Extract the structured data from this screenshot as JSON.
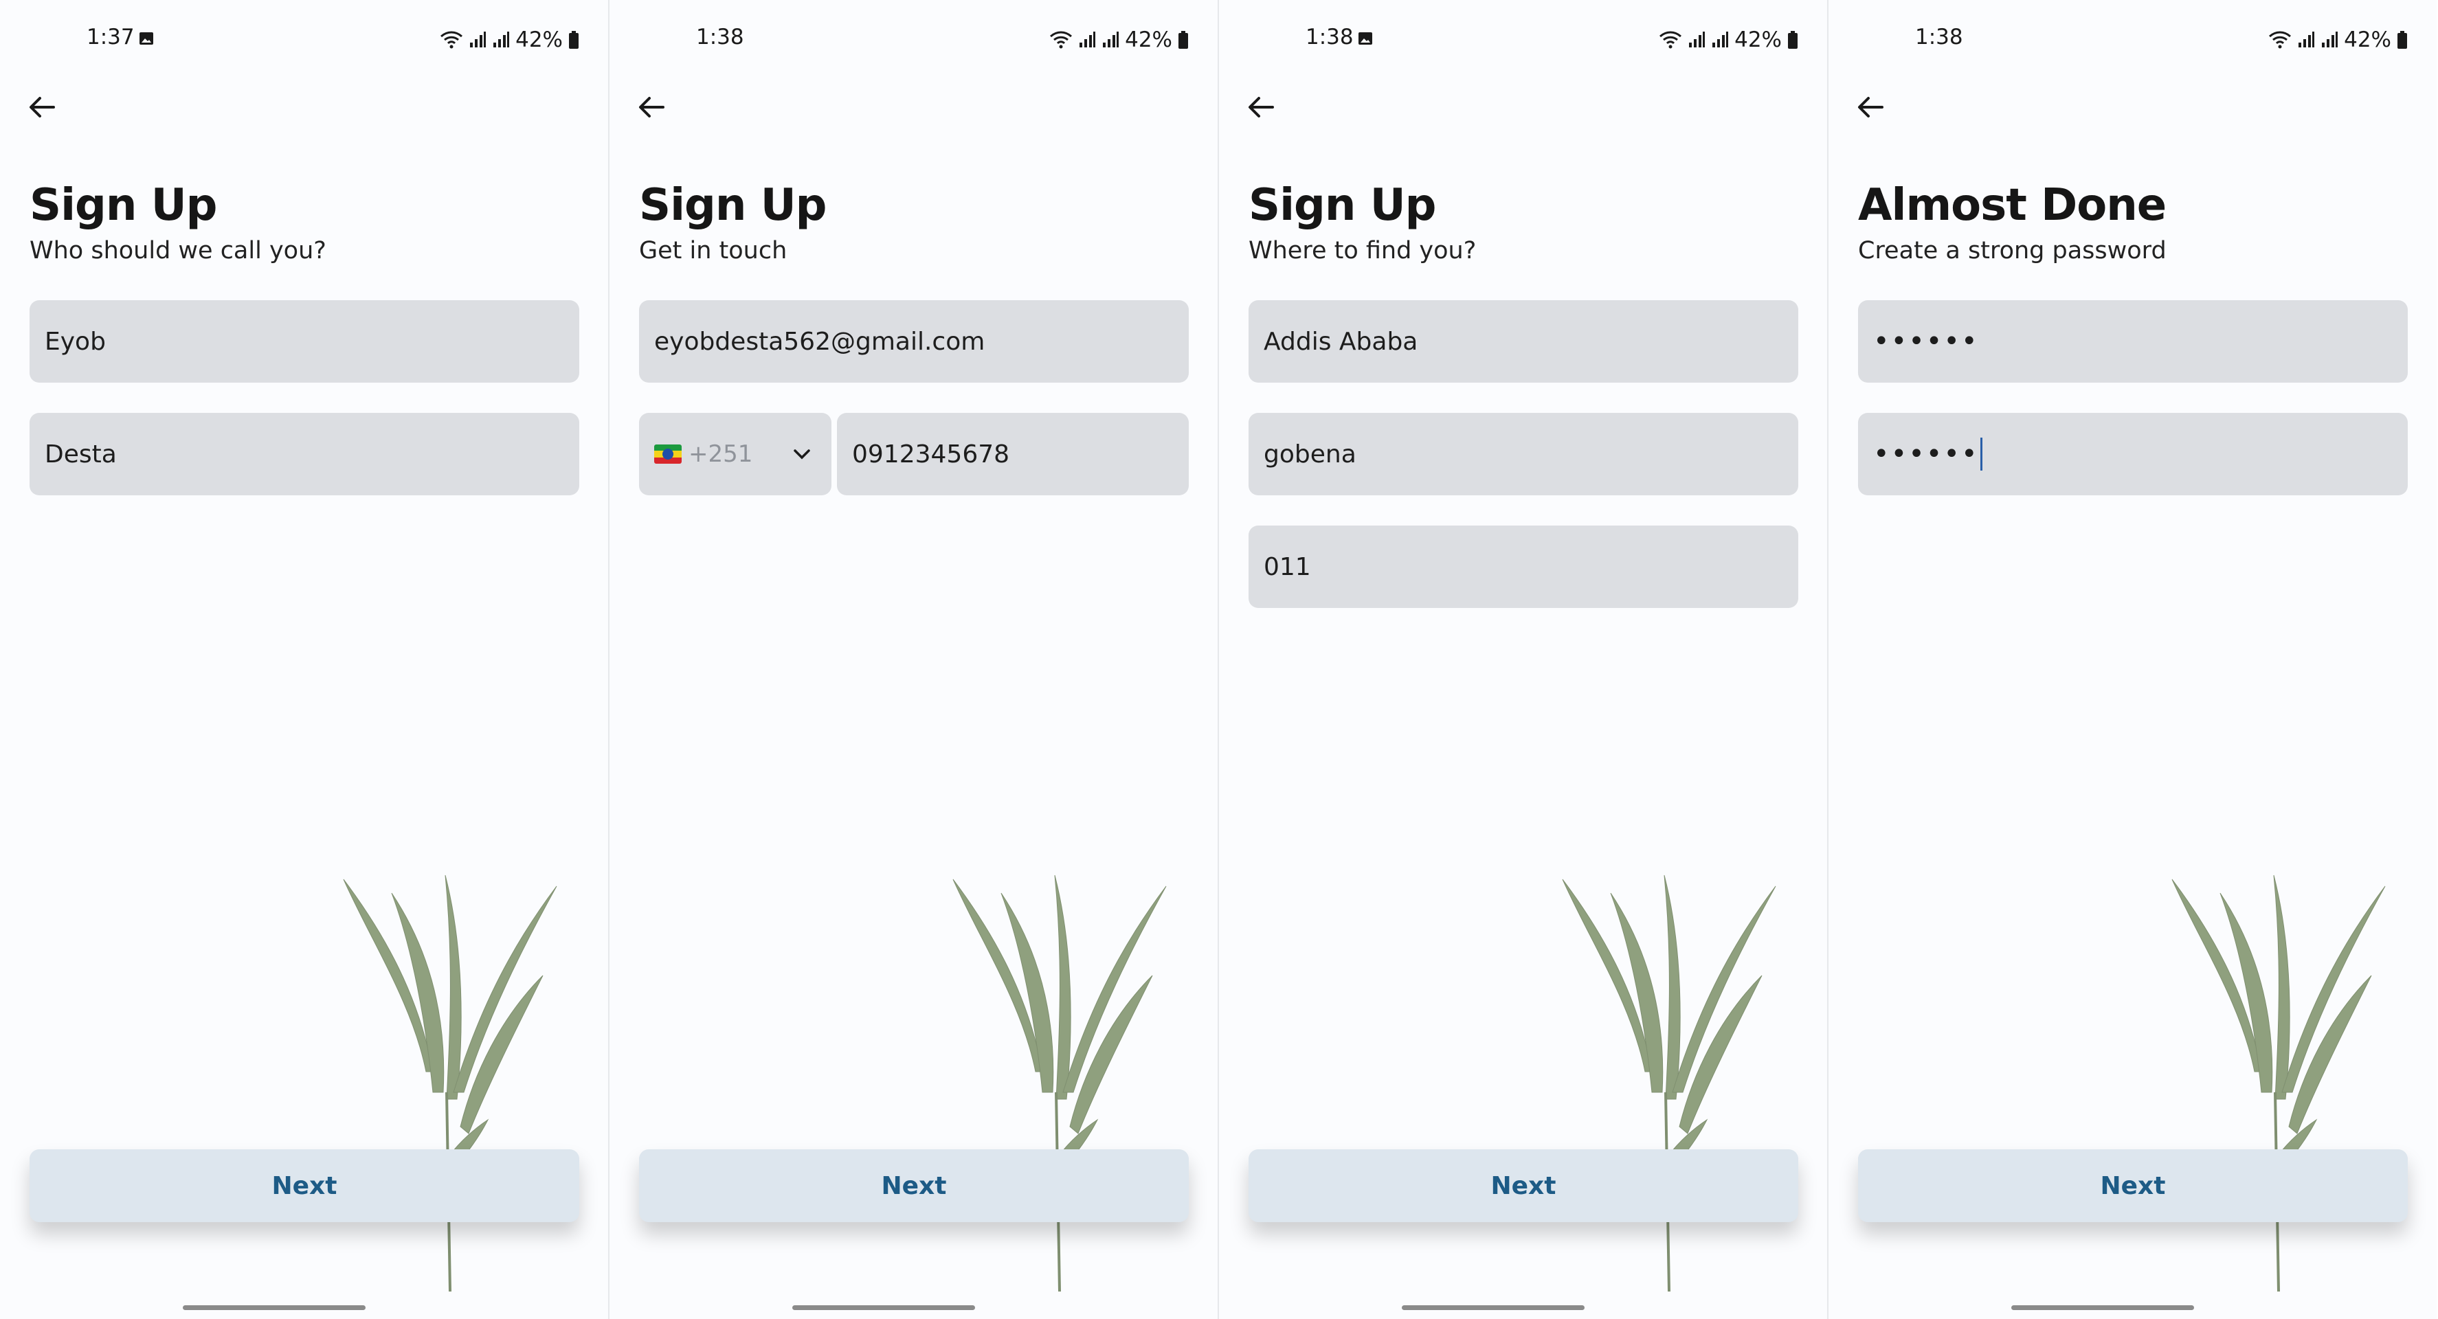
{
  "screens": [
    {
      "status": {
        "time": "1:37",
        "battery": "42%"
      },
      "title": "Sign Up",
      "subtitle": "Who should we call you?",
      "fields": [
        {
          "value": "Eyob"
        },
        {
          "value": "Desta"
        }
      ],
      "next_label": "Next"
    },
    {
      "status": {
        "time": "1:38",
        "battery": "42%"
      },
      "title": "Sign Up",
      "subtitle": "Get in touch",
      "fields": [
        {
          "value": "eyobdesta562@gmail.com"
        }
      ],
      "phone": {
        "country_code": "+251",
        "number": "0912345678"
      },
      "next_label": "Next"
    },
    {
      "status": {
        "time": "1:38",
        "battery": "42%"
      },
      "title": "Sign Up",
      "subtitle": "Where to find you?",
      "fields": [
        {
          "value": "Addis Ababa"
        },
        {
          "value": "gobena"
        },
        {
          "value": "011"
        }
      ],
      "next_label": "Next"
    },
    {
      "status": {
        "time": "1:38",
        "battery": "42%"
      },
      "title": "Almost Done",
      "subtitle": "Create a strong password",
      "fields": [
        {
          "value": "••••••"
        },
        {
          "value": "••••••"
        }
      ],
      "next_label": "Next"
    }
  ],
  "colors": {
    "background": "#fbfcfe",
    "field": "#dcdee2",
    "button": "#dde6ee",
    "button_text": "#1d5b86",
    "caret": "#2a5fa8"
  },
  "icons": [
    "back-arrow-icon",
    "wifi-icon",
    "signal-icon",
    "battery-icon",
    "gallery-icon",
    "chevron-down-icon",
    "ethiopia-flag-icon"
  ]
}
